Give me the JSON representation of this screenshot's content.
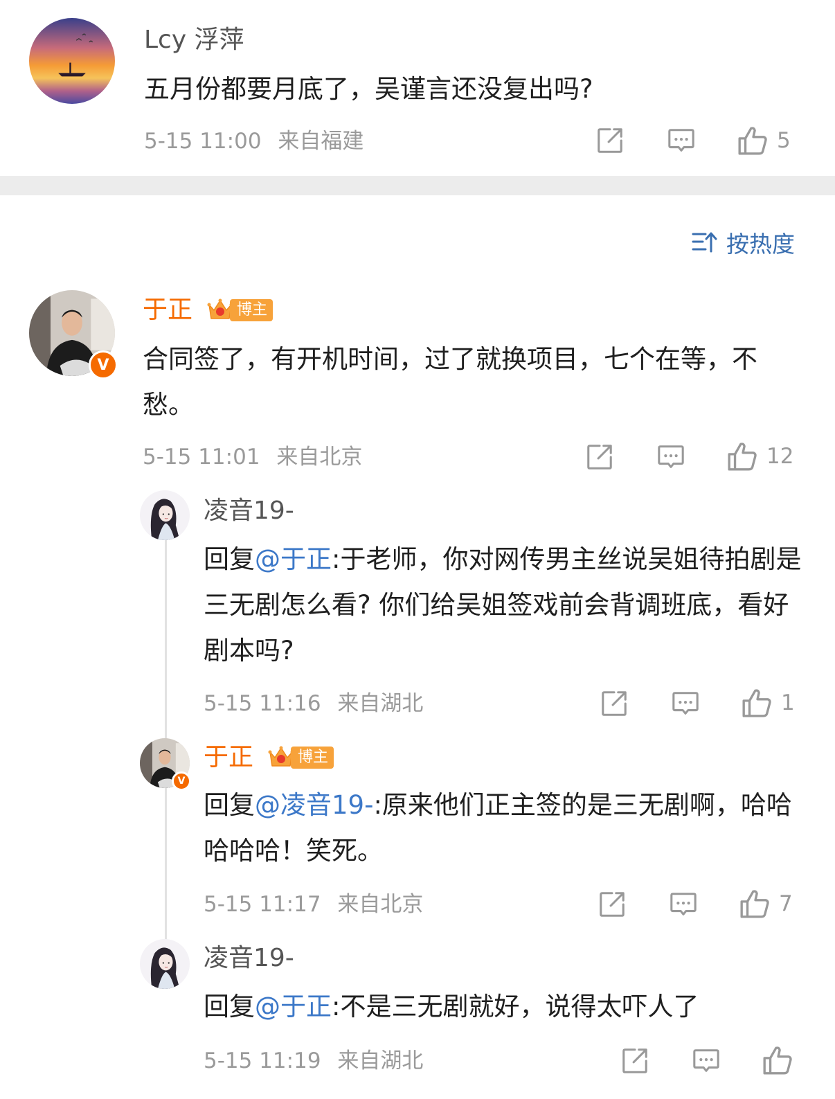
{
  "post": {
    "user": "Lcy 浮萍",
    "text": "五月份都要月底了，吴谨言还没复出吗?",
    "time": "5-15 11:00",
    "location": "来自福建",
    "likes": "5"
  },
  "sort_label": "按热度",
  "comment": {
    "user": "于正",
    "badge": "博主",
    "text": "合同签了，有开机时间，过了就换项目，七个在等，不愁。",
    "time": "5-15 11:01",
    "location": "来自北京",
    "likes": "12"
  },
  "replies": [
    {
      "user": "凌音19-",
      "reply_prefix": "回复",
      "mention": "@于正",
      "text": ":于老师，你对网传男主丝说吴姐待拍剧是三无剧怎么看? 你们给吴姐签戏前会背调班底，看好剧本吗?",
      "time": "5-15 11:16",
      "location": "来自湖北",
      "likes": "1"
    },
    {
      "user": "于正",
      "badge": "博主",
      "reply_prefix": "回复",
      "mention": "@凌音19-",
      "text": ":原来他们正主签的是三无剧啊，哈哈哈哈哈！笑死。",
      "time": "5-15 11:17",
      "location": "来自北京",
      "likes": "7"
    },
    {
      "user": "凌音19-",
      "reply_prefix": "回复",
      "mention": "@于正",
      "text": ":不是三无剧就好，说得太吓人了",
      "time": "5-15 11:19",
      "location": "来自湖北",
      "likes": ""
    }
  ],
  "icons": {
    "share": "share-icon",
    "comment": "comment-icon",
    "like": "thumbs-up-icon",
    "sort": "sort-icon",
    "verified": "verified-v-icon",
    "crown": "crown-icon"
  },
  "colors": {
    "name_highlight": "#f56a00",
    "mention": "#3c78c8",
    "sort": "#3a6fb0",
    "meta": "#9a9a9a",
    "badge": "#f7a23a"
  }
}
